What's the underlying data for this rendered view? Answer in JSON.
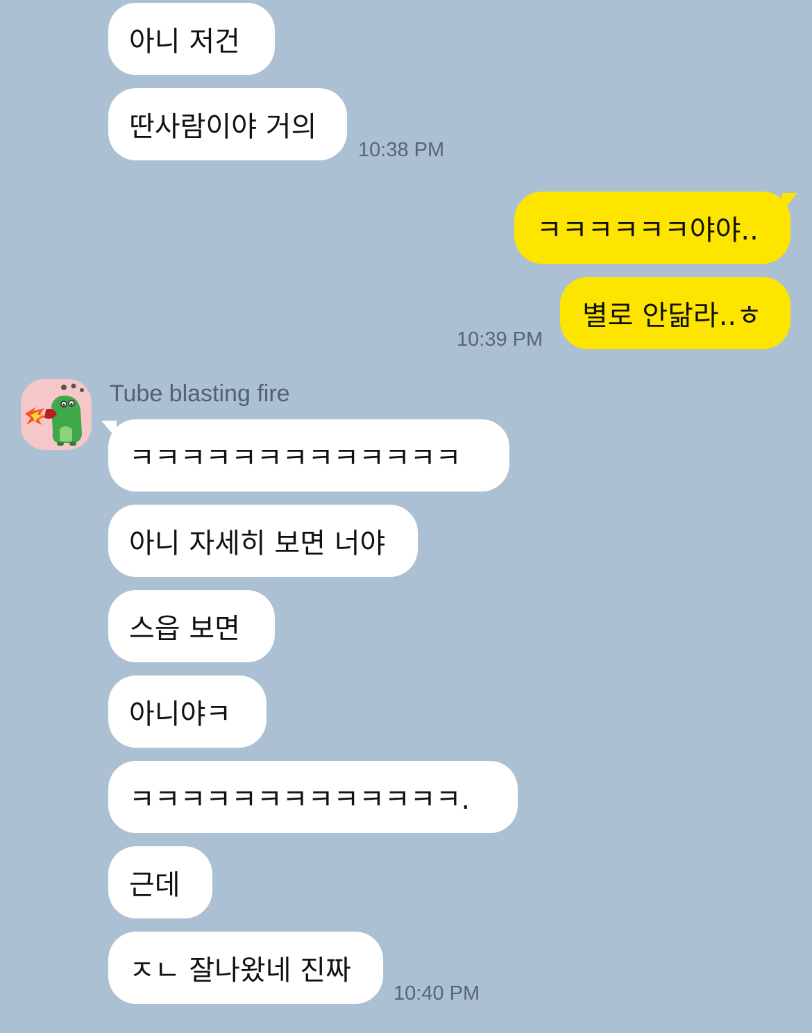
{
  "sender": {
    "name": "Tube blasting fire",
    "avatar_icon": "tube-blasting-fire-sticker-icon"
  },
  "colors": {
    "background": "#abc0d2",
    "incoming_bubble": "#ffffff",
    "outgoing_bubble": "#fee500",
    "timestamp": "#596573"
  },
  "messages": [
    {
      "text": "아니 저건",
      "direction": "in"
    },
    {
      "text": "딴사람이야 거의",
      "direction": "in",
      "time": "10:38 PM"
    },
    {
      "text": "ㅋㅋㅋㅋㅋㅋ야야..",
      "direction": "out"
    },
    {
      "text": "별로 안닮라..ㅎ",
      "direction": "out",
      "time": "10:39 PM"
    },
    {
      "text": "ㅋㅋㅋㅋㅋㅋㅋㅋㅋㅋㅋㅋㅋ",
      "direction": "in"
    },
    {
      "text": "아니 자세히 보면 너야",
      "direction": "in"
    },
    {
      "text": "스읍 보면",
      "direction": "in"
    },
    {
      "text": "아니야ㅋ",
      "direction": "in"
    },
    {
      "text": "ㅋㅋㅋㅋㅋㅋㅋㅋㅋㅋㅋㅋㅋ.",
      "direction": "in"
    },
    {
      "text": "근데",
      "direction": "in"
    },
    {
      "text": "ㅈㄴ 잘나왔네 진짜",
      "direction": "in",
      "time": "10:40 PM"
    }
  ]
}
